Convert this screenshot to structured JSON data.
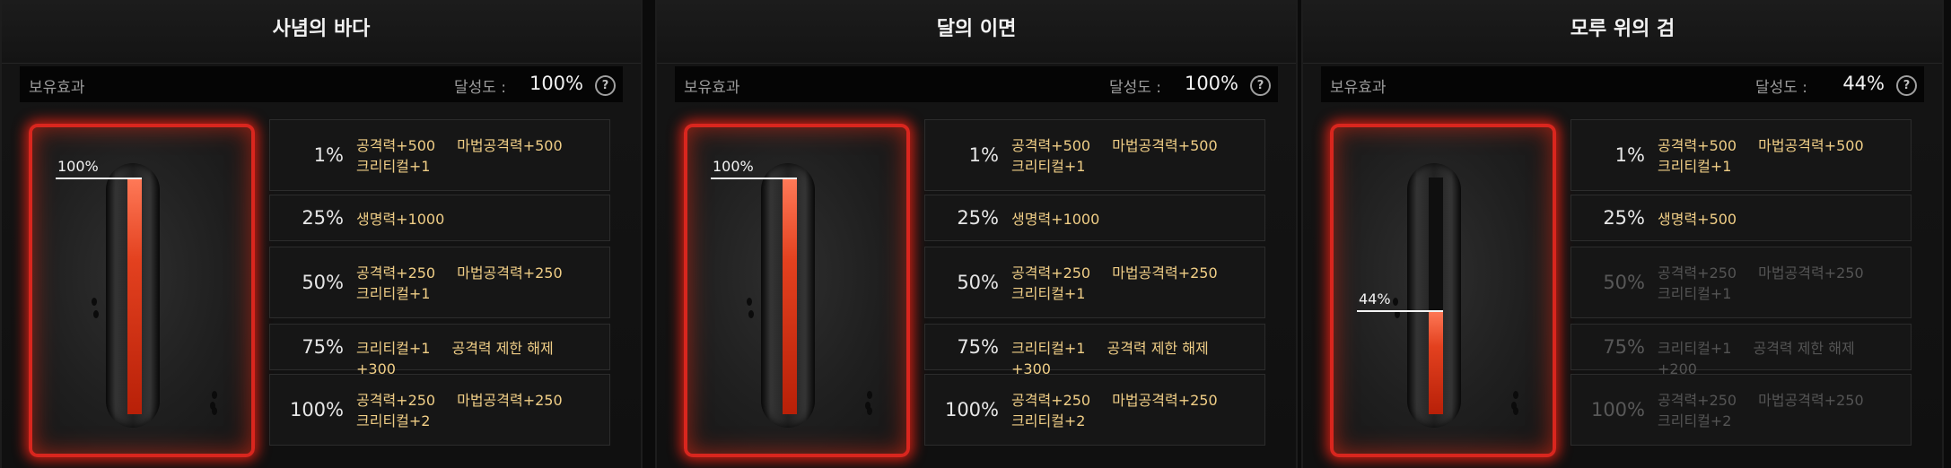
{
  "header": {
    "effect_label": "보유효과",
    "achievement_label": "달성도 :",
    "help_icon": "question-circle-icon"
  },
  "colors": {
    "active_text": "#f0ce86",
    "inactive_text": "#545454",
    "glow": "#d9261e",
    "gauge": "#e3411f"
  },
  "panels": [
    {
      "title": "사념의 바다",
      "achievement": "100%",
      "progress": 1.0,
      "gauge_label": "100%",
      "tiers": [
        {
          "pct": "1%",
          "lines": [
            [
              "공격력+500",
              "마법공격력+500"
            ],
            [
              "크리티컬+1"
            ]
          ],
          "active": true
        },
        {
          "pct": "25%",
          "lines": [
            [
              "생명력+1000"
            ]
          ],
          "active": true
        },
        {
          "pct": "50%",
          "lines": [
            [
              "공격력+250",
              "마법공격력+250"
            ],
            [
              "크리티컬+1"
            ]
          ],
          "active": true
        },
        {
          "pct": "75%",
          "lines": [
            [
              "크리티컬+1",
              "공격력 제한 해제+300"
            ]
          ],
          "active": true
        },
        {
          "pct": "100%",
          "lines": [
            [
              "공격력+250",
              "마법공격력+250"
            ],
            [
              "크리티컬+2"
            ]
          ],
          "active": true
        }
      ]
    },
    {
      "title": "달의 이면",
      "achievement": "100%",
      "progress": 1.0,
      "gauge_label": "100%",
      "tiers": [
        {
          "pct": "1%",
          "lines": [
            [
              "공격력+500",
              "마법공격력+500"
            ],
            [
              "크리티컬+1"
            ]
          ],
          "active": true
        },
        {
          "pct": "25%",
          "lines": [
            [
              "생명력+1000"
            ]
          ],
          "active": true
        },
        {
          "pct": "50%",
          "lines": [
            [
              "공격력+250",
              "마법공격력+250"
            ],
            [
              "크리티컬+1"
            ]
          ],
          "active": true
        },
        {
          "pct": "75%",
          "lines": [
            [
              "크리티컬+1",
              "공격력 제한 해제+300"
            ]
          ],
          "active": true
        },
        {
          "pct": "100%",
          "lines": [
            [
              "공격력+250",
              "마법공격력+250"
            ],
            [
              "크리티컬+2"
            ]
          ],
          "active": true
        }
      ]
    },
    {
      "title": "모루 위의 검",
      "achievement": "44%",
      "progress": 0.44,
      "gauge_label": "44%",
      "tiers": [
        {
          "pct": "1%",
          "lines": [
            [
              "공격력+500",
              "마법공격력+500"
            ],
            [
              "크리티컬+1"
            ]
          ],
          "active": true
        },
        {
          "pct": "25%",
          "lines": [
            [
              "생명력+500"
            ]
          ],
          "active": true
        },
        {
          "pct": "50%",
          "lines": [
            [
              "공격력+250",
              "마법공격력+250"
            ],
            [
              "크리티컬+1"
            ]
          ],
          "active": false
        },
        {
          "pct": "75%",
          "lines": [
            [
              "크리티컬+1",
              "공격력 제한 해제+200"
            ]
          ],
          "active": false
        },
        {
          "pct": "100%",
          "lines": [
            [
              "공격력+250",
              "마법공격력+250"
            ],
            [
              "크리티컬+2"
            ]
          ],
          "active": false
        }
      ]
    }
  ]
}
